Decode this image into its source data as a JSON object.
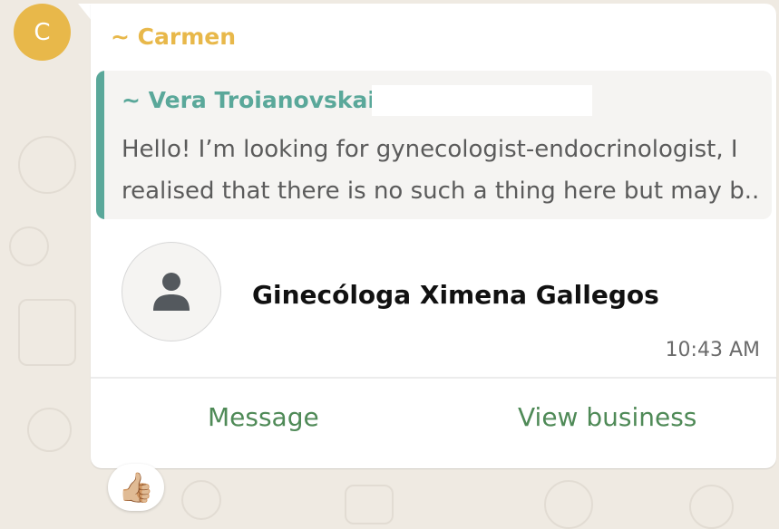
{
  "sender": {
    "avatar_initial": "C",
    "name": "~ Carmen",
    "color": "#e8b84a"
  },
  "quoted_message": {
    "author": "~ Vera Troianovskaia",
    "accent_color": "#5aa89a",
    "line1": "Hello! I’m looking for gynecologist-endocrinologist, I",
    "line2": "realised that there is no such a thing here but may b..."
  },
  "contact_card": {
    "name": "Ginecóloga Ximena Gallegos",
    "avatar_icon": "person-icon",
    "time": "10:43 AM"
  },
  "actions": {
    "message_label": "Message",
    "view_business_label": "View business",
    "color": "#4f8a57"
  },
  "reaction": {
    "emoji": "👍🏼",
    "icon": "thumbs-up-icon"
  },
  "colors": {
    "background": "#efeae2",
    "bubble": "#ffffff"
  }
}
